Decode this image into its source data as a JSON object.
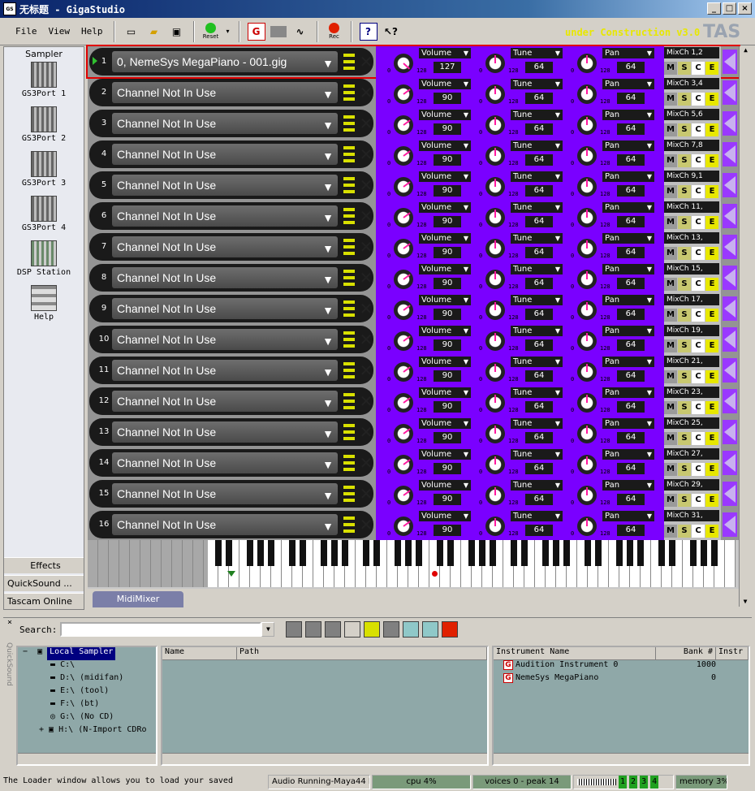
{
  "title": "无标题 - GigaStudio",
  "window_buttons": {
    "minimize": "_",
    "maximize": "□",
    "close": "×"
  },
  "menu": [
    "File",
    "View",
    "Help"
  ],
  "toolbar": {
    "reset_label": "Reset",
    "rec_label": "Rec",
    "construction": "under Construction v3.0",
    "brand_fragment": "TAS"
  },
  "sampler": {
    "header": "Sampler",
    "items": [
      "GS3Port 1",
      "GS3Port 2",
      "GS3Port 3",
      "GS3Port 4",
      "DSP Station",
      "Help"
    ],
    "bottom": [
      "Effects",
      "QuickSound ...",
      "Tascam Online"
    ]
  },
  "rack_labels": {
    "volume": "Volume",
    "tune": "Tune",
    "pan": "Pan",
    "m": "M",
    "s": "S",
    "c": "C",
    "e": "E",
    "min": "0",
    "max": "128"
  },
  "channels": [
    {
      "num": "1",
      "name": "0, NemeSys MegaPiano - 001.gig",
      "volume": "127",
      "tune": "64",
      "pan": "64",
      "mix": "MixCh 1,2",
      "vol_pct": 99
    },
    {
      "num": "2",
      "name": "Channel Not In Use",
      "volume": "90",
      "tune": "64",
      "pan": "64",
      "mix": "MixCh 3,4",
      "vol_pct": 70
    },
    {
      "num": "3",
      "name": "Channel Not In Use",
      "volume": "90",
      "tune": "64",
      "pan": "64",
      "mix": "MixCh 5,6",
      "vol_pct": 70
    },
    {
      "num": "4",
      "name": "Channel Not In Use",
      "volume": "90",
      "tune": "64",
      "pan": "64",
      "mix": "MixCh 7,8",
      "vol_pct": 70
    },
    {
      "num": "5",
      "name": "Channel Not In Use",
      "volume": "90",
      "tune": "64",
      "pan": "64",
      "mix": "MixCh 9,1",
      "vol_pct": 70
    },
    {
      "num": "6",
      "name": "Channel Not In Use",
      "volume": "90",
      "tune": "64",
      "pan": "64",
      "mix": "MixCh 11,",
      "vol_pct": 70
    },
    {
      "num": "7",
      "name": "Channel Not In Use",
      "volume": "90",
      "tune": "64",
      "pan": "64",
      "mix": "MixCh 13,",
      "vol_pct": 70
    },
    {
      "num": "8",
      "name": "Channel Not In Use",
      "volume": "90",
      "tune": "64",
      "pan": "64",
      "mix": "MixCh 15,",
      "vol_pct": 70
    },
    {
      "num": "9",
      "name": "Channel Not In Use",
      "volume": "90",
      "tune": "64",
      "pan": "64",
      "mix": "MixCh 17,",
      "vol_pct": 70
    },
    {
      "num": "10",
      "name": "Channel Not In Use",
      "volume": "90",
      "tune": "64",
      "pan": "64",
      "mix": "MixCh 19,",
      "vol_pct": 70
    },
    {
      "num": "11",
      "name": "Channel Not In Use",
      "volume": "90",
      "tune": "64",
      "pan": "64",
      "mix": "MixCh 21,",
      "vol_pct": 70
    },
    {
      "num": "12",
      "name": "Channel Not In Use",
      "volume": "90",
      "tune": "64",
      "pan": "64",
      "mix": "MixCh 23,",
      "vol_pct": 70
    },
    {
      "num": "13",
      "name": "Channel Not In Use",
      "volume": "90",
      "tune": "64",
      "pan": "64",
      "mix": "MixCh 25,",
      "vol_pct": 70
    },
    {
      "num": "14",
      "name": "Channel Not In Use",
      "volume": "90",
      "tune": "64",
      "pan": "64",
      "mix": "MixCh 27,",
      "vol_pct": 70
    },
    {
      "num": "15",
      "name": "Channel Not In Use",
      "volume": "90",
      "tune": "64",
      "pan": "64",
      "mix": "MixCh 29,",
      "vol_pct": 70
    },
    {
      "num": "16",
      "name": "Channel Not In Use",
      "volume": "90",
      "tune": "64",
      "pan": "64",
      "mix": "MixCh 31,",
      "vol_pct": 70
    }
  ],
  "midimixer_tab": "MidiMixer",
  "quicksound": {
    "side_label": "QuickSound",
    "search_label": "Search:",
    "search_value": "",
    "tree": [
      "Local Sampler",
      "C:\\",
      "D:\\ (midifan)",
      "E:\\ (tool)",
      "F:\\ (bt)",
      "G:\\ (No CD)",
      "H:\\ (N-Import CDRo"
    ],
    "files_cols": [
      "Name",
      "Path"
    ],
    "inst_cols": [
      "Instrument Name",
      "Bank #",
      "Instr"
    ],
    "instruments": [
      {
        "name": "Audition Instrument 0",
        "bank": "1000"
      },
      {
        "name": "NemeSys MegaPiano",
        "bank": "0"
      }
    ]
  },
  "status": {
    "msg": "The Loader window allows you to load your saved",
    "audio": "Audio Running-Maya44 P",
    "cpu": "cpu 4%",
    "voices": "voices 0 - peak 14",
    "ports": [
      "1",
      "2",
      "3",
      "4"
    ],
    "memory": "memory 3%"
  }
}
